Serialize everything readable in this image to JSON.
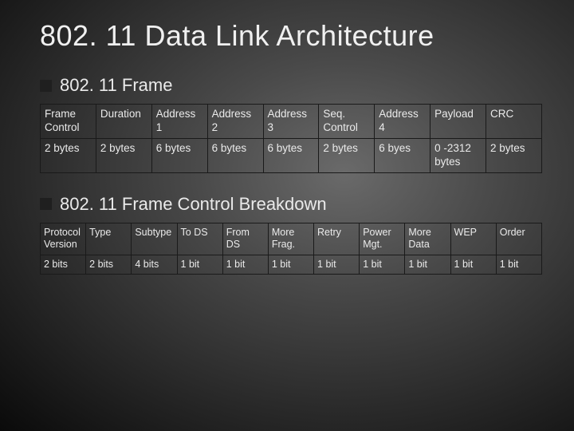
{
  "title": "802. 11 Data Link Architecture",
  "section1": {
    "heading": "802. 11 Frame"
  },
  "section2": {
    "heading": "802. 11 Frame Control Breakdown"
  },
  "table1": {
    "headers": [
      "Frame Control",
      "Duration",
      "Address 1",
      "Address 2",
      "Address 3",
      "Seq. Control",
      "Address 4",
      "Payload",
      "CRC"
    ],
    "row": [
      "2 bytes",
      "2 bytes",
      "6 bytes",
      "6 bytes",
      "6 bytes",
      "2 bytes",
      "6 byes",
      "0 -2312 bytes",
      "2 bytes"
    ]
  },
  "table2": {
    "headers": [
      "Protocol Version",
      "Type",
      "Subtype",
      "To DS",
      "From DS",
      "More Frag.",
      "Retry",
      "Power Mgt.",
      "More Data",
      "WEP",
      "Order"
    ],
    "row": [
      "2 bits",
      "2 bits",
      "4 bits",
      "1 bit",
      "1 bit",
      "1 bit",
      "1 bit",
      "1 bit",
      "1 bit",
      "1 bit",
      "1 bit"
    ]
  },
  "chart_data": [
    {
      "type": "table",
      "title": "802.11 Frame",
      "columns": [
        "Frame Control",
        "Duration",
        "Address 1",
        "Address 2",
        "Address 3",
        "Seq. Control",
        "Address 4",
        "Payload",
        "CRC"
      ],
      "rows": [
        [
          "2 bytes",
          "2 bytes",
          "6 bytes",
          "6 bytes",
          "6 bytes",
          "2 bytes",
          "6 byes",
          "0 -2312 bytes",
          "2 bytes"
        ]
      ]
    },
    {
      "type": "table",
      "title": "802.11 Frame Control Breakdown",
      "columns": [
        "Protocol Version",
        "Type",
        "Subtype",
        "To DS",
        "From DS",
        "More Frag.",
        "Retry",
        "Power Mgt.",
        "More Data",
        "WEP",
        "Order"
      ],
      "rows": [
        [
          "2 bits",
          "2 bits",
          "4 bits",
          "1 bit",
          "1 bit",
          "1 bit",
          "1 bit",
          "1 bit",
          "1 bit",
          "1 bit",
          "1 bit"
        ]
      ]
    }
  ]
}
